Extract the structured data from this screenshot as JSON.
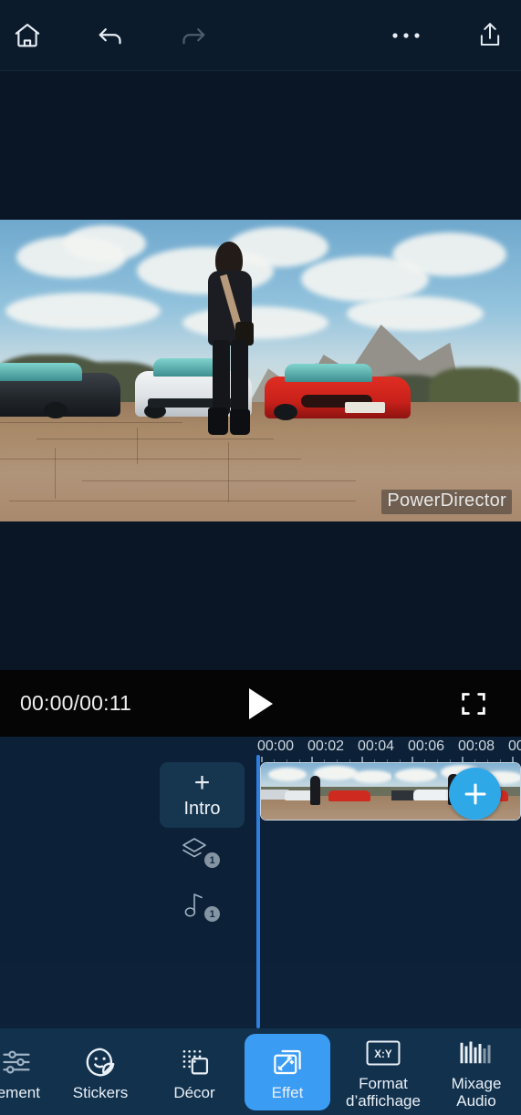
{
  "app": {
    "name": "PowerDirector",
    "watermark": "PowerDirector",
    "accent_blue": "#3b9cf4",
    "playhead_blue": "#2f7fe0",
    "add_button_blue": "#2fa8e8",
    "timeline_bg": "#0c2138",
    "topbar_bg": "#0b1b2c",
    "bottombar_bg": "#12314d"
  },
  "topbar": {
    "items": [
      {
        "name": "home-icon",
        "label": "Home",
        "enabled": true
      },
      {
        "name": "undo-icon",
        "label": "Undo",
        "enabled": true
      },
      {
        "name": "redo-icon",
        "label": "Redo",
        "enabled": false
      },
      {
        "name": "more-options-icon",
        "label": "More",
        "enabled": true
      },
      {
        "name": "export-icon",
        "label": "Export",
        "enabled": true
      }
    ]
  },
  "preview": {
    "watermark": "PowerDirector"
  },
  "playback": {
    "current_time": "00:00",
    "total_time": "00:11",
    "time_display": "00:00/00:11",
    "play_label": "Play",
    "fullscreen_label": "Fullscreen"
  },
  "timeline": {
    "ruler_labels": [
      "00:00",
      "00:02",
      "00:04",
      "00:06",
      "00:08",
      "00"
    ],
    "intro": {
      "plus": "+",
      "label": "Intro"
    },
    "tracks": [
      {
        "name": "overlay-track",
        "icon": "layers-icon",
        "badge": "1"
      },
      {
        "name": "audio-track",
        "icon": "music-note-icon",
        "badge": "1"
      }
    ],
    "add_clip_label": "+"
  },
  "bottombar": {
    "tools": [
      {
        "name": "traitement",
        "label": "tement",
        "icon": "sliders-icon",
        "selected": false
      },
      {
        "name": "stickers",
        "label": "Stickers",
        "icon": "sticker-smiley-icon",
        "selected": false
      },
      {
        "name": "decor",
        "label": "Décor",
        "icon": "decor-grid-icon",
        "selected": false
      },
      {
        "name": "effet",
        "label": "Effet",
        "icon": "magic-wand-icon",
        "selected": true
      },
      {
        "name": "format-affichage",
        "label": "Format\nd’affichage",
        "icon": "aspect-ratio-icon",
        "selected": false
      },
      {
        "name": "mixage-audio",
        "label": "Mixage Audio",
        "icon": "audio-mixer-icon",
        "selected": false
      }
    ]
  }
}
